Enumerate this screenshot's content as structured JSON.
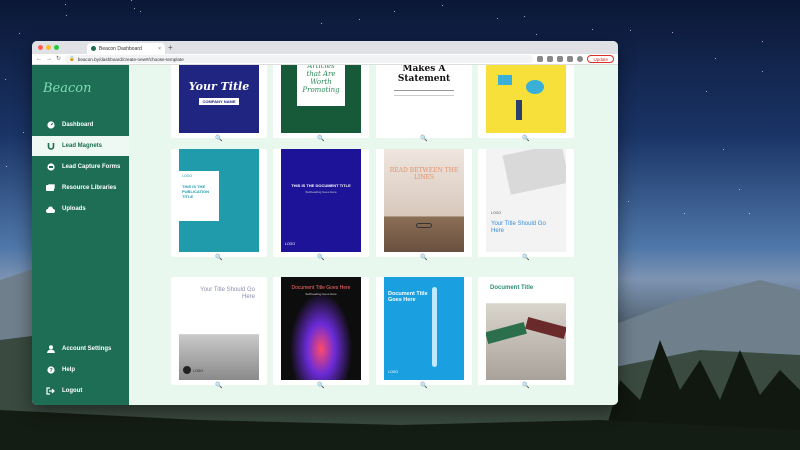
{
  "browser": {
    "tab_title": "Beacon Dashboard",
    "tab_close": "×",
    "new_tab": "+",
    "url": "beacon.by/dashboard/create-new#/choose-template",
    "update_label": "Update"
  },
  "sidebar": {
    "logo": "Beacon",
    "items": [
      {
        "label": "Dashboard",
        "icon": "dashboard-gauge-icon"
      },
      {
        "label": "Lead Magnets",
        "icon": "magnet-icon"
      },
      {
        "label": "Lead Capture Forms",
        "icon": "form-icon"
      },
      {
        "label": "Resource Libraries",
        "icon": "library-icon"
      },
      {
        "label": "Uploads",
        "icon": "cloud-upload-icon"
      }
    ],
    "bottom_items": [
      {
        "label": "Account Settings",
        "icon": "user-icon"
      },
      {
        "label": "Help",
        "icon": "help-icon"
      },
      {
        "label": "Logout",
        "icon": "logout-icon"
      }
    ]
  },
  "templates": [
    {
      "title": "Your Title",
      "subtitle": "COMPANY NAME"
    },
    {
      "title": "Articles that Are Worth Promoting"
    },
    {
      "title": "Makes A Statement"
    },
    {
      "title": ""
    },
    {
      "title": "THIS IS THE PUBLICATION TITLE",
      "logo": "LOGO"
    },
    {
      "title": "THIS IS THE DOCUMENT TITLE",
      "subtitle": "Subheading Goes Here",
      "logo": "LOGO"
    },
    {
      "title": "READ BETWEEN THE LINES"
    },
    {
      "title": "Your Title Should Go Here",
      "logo": "LOGO"
    },
    {
      "title": "Your Title Should Go Here",
      "logo": "LOGO"
    },
    {
      "title": "Document Title Goes Here",
      "subtitle": "Subheading Goes Here"
    },
    {
      "title": "Document Title Goes Here",
      "logo": "LOGO"
    },
    {
      "title": "Document Title"
    }
  ],
  "colors": {
    "sidebar": "#1d6e55",
    "main_bg": "#e8f8ef",
    "accent": "#7fdcb0"
  }
}
